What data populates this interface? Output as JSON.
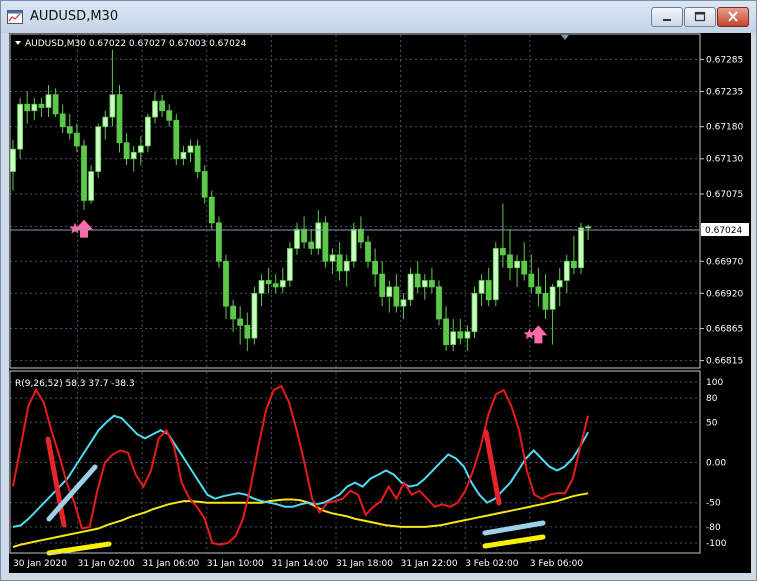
{
  "window": {
    "title": "AUDUSD,M30",
    "minimize_icon": "minimize-icon",
    "maximize_icon": "maximize-icon",
    "close_icon": "close-icon"
  },
  "colors": {
    "background": "#000000",
    "grid": "#46506a",
    "bull_candle": "#c8ffc0",
    "bear_candle": "#5dc94a",
    "arrow": "#ff6aa8",
    "rsi_fast": "#e81b1b",
    "rsi_mid": "#4fd9f2",
    "rsi_slow": "#f5e617",
    "marker_red": "#e8242a",
    "marker_blue": "#9fd0ea",
    "marker_yellow": "#f8f000",
    "text": "#ffffff",
    "price_line": "#8c9ab5"
  },
  "chart": {
    "header": "AUDUSD,M30  0.67022 0.67027 0.67003 0.67024",
    "current_price": "0.67024",
    "price_ticks": [
      "0.67285",
      "0.67235",
      "0.67180",
      "0.67130",
      "0.67075",
      "0.67024",
      "0.66970",
      "0.66920",
      "0.66865",
      "0.66815"
    ],
    "time_ticks": [
      "30 Jan 2020",
      "31 Jan 02:00",
      "31 Jan 06:00",
      "31 Jan 10:00",
      "31 Jan 14:00",
      "31 Jan 18:00",
      "31 Jan 22:00",
      "3 Feb 02:00",
      "3 Feb 06:00"
    ],
    "indicator_header": "R(9,26,52) 58.3 37.7 -38.3",
    "indicator_ticks": [
      "100",
      "80",
      "50",
      "0.00",
      "-50",
      "-80",
      "-100"
    ],
    "arrow_icon": "pink-up-arrow-icon",
    "star_icon": "pink-star-icon"
  },
  "chart_data": {
    "type": "candlestick",
    "symbol": "AUDUSD",
    "timeframe": "M30",
    "ohlc_last": {
      "open": 0.67022,
      "high": 0.67027,
      "low": 0.67003,
      "close": 0.67024
    },
    "price_range": [
      0.66805,
      0.6732
    ],
    "candles": [
      [
        0.6711,
        0.6716,
        0.6708,
        0.67145
      ],
      [
        0.67145,
        0.67225,
        0.6713,
        0.67215
      ],
      [
        0.67215,
        0.67235,
        0.67185,
        0.67205
      ],
      [
        0.67205,
        0.67225,
        0.6719,
        0.67215
      ],
      [
        0.67215,
        0.67225,
        0.67195,
        0.6721
      ],
      [
        0.6721,
        0.67245,
        0.67195,
        0.6723
      ],
      [
        0.6723,
        0.6724,
        0.67195,
        0.672
      ],
      [
        0.672,
        0.67215,
        0.6717,
        0.6718
      ],
      [
        0.6718,
        0.672,
        0.6716,
        0.6717
      ],
      [
        0.6717,
        0.67185,
        0.6714,
        0.6715
      ],
      [
        0.6715,
        0.6716,
        0.6705,
        0.67065
      ],
      [
        0.67065,
        0.6712,
        0.6706,
        0.6711
      ],
      [
        0.6711,
        0.67185,
        0.671,
        0.6718
      ],
      [
        0.6718,
        0.67205,
        0.6716,
        0.67195
      ],
      [
        0.67195,
        0.673,
        0.6718,
        0.6723
      ],
      [
        0.6723,
        0.67245,
        0.6714,
        0.67155
      ],
      [
        0.67155,
        0.6717,
        0.6712,
        0.6713
      ],
      [
        0.6713,
        0.6715,
        0.6711,
        0.6714
      ],
      [
        0.6714,
        0.67165,
        0.6712,
        0.6715
      ],
      [
        0.6715,
        0.672,
        0.6714,
        0.67195
      ],
      [
        0.67195,
        0.67235,
        0.67185,
        0.6722
      ],
      [
        0.6722,
        0.6723,
        0.67195,
        0.67205
      ],
      [
        0.67205,
        0.67215,
        0.6718,
        0.6719
      ],
      [
        0.6719,
        0.672,
        0.6712,
        0.6713
      ],
      [
        0.6713,
        0.6715,
        0.6712,
        0.6714
      ],
      [
        0.6714,
        0.6716,
        0.67125,
        0.6715
      ],
      [
        0.6715,
        0.6716,
        0.671,
        0.6711
      ],
      [
        0.6711,
        0.6712,
        0.6706,
        0.6707
      ],
      [
        0.6707,
        0.6708,
        0.6702,
        0.6703
      ],
      [
        0.6703,
        0.6704,
        0.6696,
        0.6697
      ],
      [
        0.6697,
        0.6698,
        0.6688,
        0.669
      ],
      [
        0.669,
        0.6691,
        0.6686,
        0.6688
      ],
      [
        0.6688,
        0.669,
        0.6684,
        0.6687
      ],
      [
        0.6687,
        0.6689,
        0.6683,
        0.6685
      ],
      [
        0.6685,
        0.6693,
        0.6684,
        0.6692
      ],
      [
        0.6692,
        0.6695,
        0.669,
        0.6694
      ],
      [
        0.6694,
        0.6696,
        0.6692,
        0.66935
      ],
      [
        0.66935,
        0.6695,
        0.6692,
        0.6693
      ],
      [
        0.6693,
        0.6696,
        0.6692,
        0.6694
      ],
      [
        0.6694,
        0.67,
        0.6693,
        0.6699
      ],
      [
        0.6699,
        0.6703,
        0.6698,
        0.6702
      ],
      [
        0.6702,
        0.6704,
        0.6699,
        0.67
      ],
      [
        0.67,
        0.6702,
        0.6698,
        0.6699
      ],
      [
        0.6699,
        0.6705,
        0.6698,
        0.6703
      ],
      [
        0.6703,
        0.6704,
        0.6696,
        0.6697
      ],
      [
        0.6697,
        0.6699,
        0.6695,
        0.6698
      ],
      [
        0.6698,
        0.67,
        0.6694,
        0.66955
      ],
      [
        0.66955,
        0.6698,
        0.6693,
        0.6697
      ],
      [
        0.6697,
        0.6703,
        0.6696,
        0.6702
      ],
      [
        0.6702,
        0.6704,
        0.6699,
        0.67
      ],
      [
        0.67,
        0.6701,
        0.6696,
        0.6697
      ],
      [
        0.6697,
        0.6699,
        0.6693,
        0.6695
      ],
      [
        0.6695,
        0.6697,
        0.669,
        0.66915
      ],
      [
        0.66915,
        0.6694,
        0.6689,
        0.6693
      ],
      [
        0.6693,
        0.6695,
        0.6689,
        0.669
      ],
      [
        0.669,
        0.6692,
        0.6688,
        0.6691
      ],
      [
        0.6691,
        0.6696,
        0.669,
        0.6695
      ],
      [
        0.6695,
        0.6697,
        0.6692,
        0.6693
      ],
      [
        0.6693,
        0.6695,
        0.6691,
        0.6694
      ],
      [
        0.6694,
        0.6696,
        0.6692,
        0.6693
      ],
      [
        0.6693,
        0.6694,
        0.6687,
        0.6688
      ],
      [
        0.6688,
        0.669,
        0.6683,
        0.6684
      ],
      [
        0.6684,
        0.6688,
        0.6683,
        0.6686
      ],
      [
        0.6686,
        0.6688,
        0.6684,
        0.6685
      ],
      [
        0.6685,
        0.6687,
        0.6683,
        0.6686
      ],
      [
        0.6686,
        0.6693,
        0.6685,
        0.6692
      ],
      [
        0.6692,
        0.6695,
        0.669,
        0.6694
      ],
      [
        0.6694,
        0.6696,
        0.669,
        0.6691
      ],
      [
        0.6691,
        0.67,
        0.669,
        0.6699
      ],
      [
        0.6699,
        0.6706,
        0.6696,
        0.6698
      ],
      [
        0.6698,
        0.6702,
        0.6694,
        0.6696
      ],
      [
        0.6696,
        0.6698,
        0.6693,
        0.6697
      ],
      [
        0.6697,
        0.67,
        0.6694,
        0.6695
      ],
      [
        0.6695,
        0.6698,
        0.6692,
        0.6693
      ],
      [
        0.6693,
        0.6696,
        0.669,
        0.6692
      ],
      [
        0.6692,
        0.6695,
        0.6688,
        0.66895
      ],
      [
        0.66895,
        0.66935,
        0.6684,
        0.6693
      ],
      [
        0.6693,
        0.6696,
        0.669,
        0.6694
      ],
      [
        0.6694,
        0.6698,
        0.6692,
        0.6697
      ],
      [
        0.6697,
        0.6701,
        0.6695,
        0.6696
      ],
      [
        0.6696,
        0.6703,
        0.6695,
        0.67022
      ],
      [
        0.67022,
        0.67027,
        0.67003,
        0.67024
      ]
    ],
    "arrows_up": [
      {
        "index": 10,
        "price": 0.67035
      },
      {
        "index": 74,
        "price": 0.6687
      }
    ],
    "indicator": {
      "name": "R(9,26,52)",
      "range": [
        -110,
        110
      ],
      "last_values": [
        58.3,
        37.7,
        -38.3
      ],
      "fast": [
        -30,
        20,
        70,
        90,
        75,
        40,
        10,
        -25,
        -50,
        -82,
        -80,
        -35,
        0,
        10,
        15,
        12,
        -15,
        -30,
        -10,
        30,
        40,
        20,
        -25,
        -45,
        -55,
        -70,
        -100,
        -102,
        -100,
        -92,
        -70,
        -30,
        20,
        65,
        90,
        95,
        75,
        40,
        0,
        -45,
        -62,
        -50,
        -48,
        -45,
        -35,
        -40,
        -65,
        -55,
        -48,
        -30,
        -45,
        -25,
        -40,
        -35,
        -45,
        -55,
        -52,
        -55,
        -50,
        -35,
        -10,
        20,
        60,
        85,
        90,
        70,
        40,
        -10,
        -40,
        -45,
        -40,
        -38,
        -38,
        -20,
        20,
        58
      ],
      "mid": [
        -80,
        -78,
        -70,
        -60,
        -50,
        -40,
        -30,
        -20,
        -5,
        10,
        25,
        40,
        50,
        58,
        55,
        45,
        35,
        30,
        35,
        40,
        35,
        20,
        5,
        -10,
        -25,
        -40,
        -45,
        -42,
        -40,
        -38,
        -40,
        -45,
        -48,
        -50,
        -52,
        -55,
        -55,
        -52,
        -50,
        -52,
        -50,
        -45,
        -40,
        -30,
        -25,
        -30,
        -20,
        -15,
        -10,
        -15,
        -25,
        -30,
        -28,
        -20,
        -10,
        0,
        10,
        5,
        -5,
        -25,
        -40,
        -50,
        -45,
        -35,
        -25,
        -10,
        5,
        15,
        5,
        -5,
        -10,
        -5,
        5,
        20,
        37.7
      ],
      "slow": [
        -105,
        -102,
        -100,
        -98,
        -96,
        -94,
        -92,
        -90,
        -88,
        -86,
        -84,
        -82,
        -78,
        -75,
        -72,
        -68,
        -65,
        -62,
        -58,
        -55,
        -52,
        -50,
        -48,
        -48,
        -49,
        -50,
        -50,
        -50,
        -50,
        -50,
        -50,
        -50,
        -50,
        -48,
        -47,
        -46,
        -46,
        -47,
        -50,
        -55,
        -60,
        -63,
        -65,
        -67,
        -70,
        -72,
        -74,
        -76,
        -78,
        -79,
        -80,
        -80,
        -80,
        -80,
        -79,
        -78,
        -76,
        -74,
        -72,
        -70,
        -68,
        -66,
        -64,
        -62,
        -60,
        -58,
        -56,
        -54,
        -52,
        -50,
        -48,
        -45,
        -42,
        -40,
        -38.3
      ]
    }
  }
}
